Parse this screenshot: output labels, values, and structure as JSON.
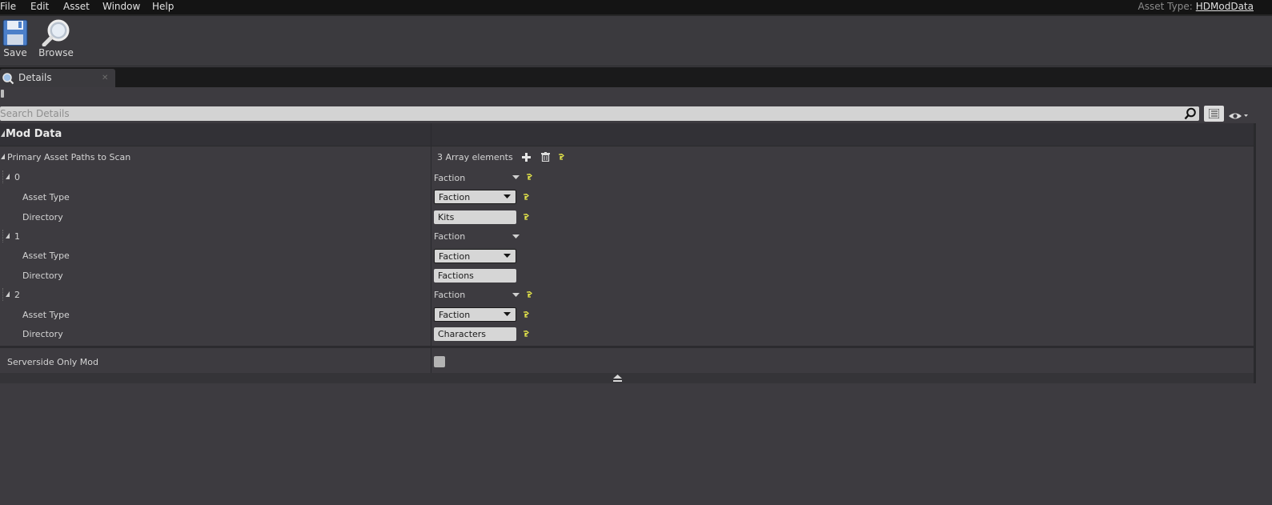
{
  "menu": [
    "File",
    "Edit",
    "Asset",
    "Window",
    "Help"
  ],
  "asset_type": {
    "label": "Asset Type:",
    "value": "HDModData"
  },
  "toolbar": {
    "save_label": "Save",
    "browse_label": "Browse"
  },
  "tab": {
    "label": "Details",
    "close": "✕"
  },
  "search": {
    "placeholder": "Search Details"
  },
  "category": {
    "label": "Mod Data"
  },
  "primary_paths": {
    "label": "Primary Asset Paths to Scan",
    "summary": "3 Array elements"
  },
  "elements": [
    {
      "index": "0",
      "header_value": "Faction",
      "asset_type_label": "Asset Type",
      "asset_type_value": "Faction",
      "directory_label": "Directory",
      "directory_value": "Kits"
    },
    {
      "index": "1",
      "header_value": "Faction",
      "asset_type_label": "Asset Type",
      "asset_type_value": "Faction",
      "directory_label": "Directory",
      "directory_value": "Factions"
    },
    {
      "index": "2",
      "header_value": "Faction",
      "asset_type_label": "Asset Type",
      "asset_type_value": "Faction",
      "directory_label": "Directory",
      "directory_value": "Characters"
    }
  ],
  "serverside": {
    "label": "Serverside Only Mod",
    "checked": false
  },
  "colors": {
    "reset_icon": "#e7e84a",
    "background": "#3d3b40",
    "menubar": "#141414"
  },
  "icons": [
    "save-icon",
    "browse-icon",
    "details-icon",
    "search-icon",
    "list-view-icon",
    "eye-icon",
    "plus-icon",
    "trash-icon",
    "reset-icon",
    "collapse-icon"
  ]
}
